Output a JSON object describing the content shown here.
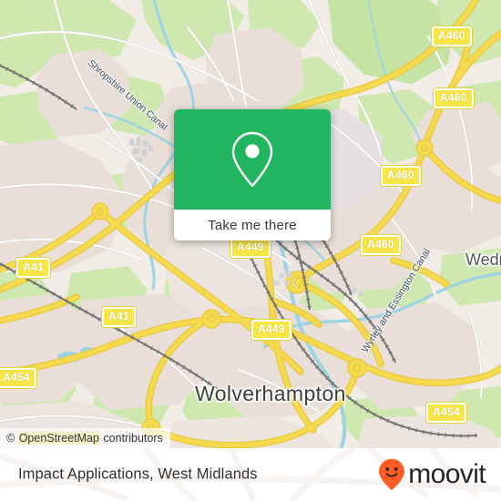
{
  "map": {
    "attribution": {
      "symbol": "©",
      "osm": "OpenStreetMap",
      "suffix": " contributors",
      "full": "© OpenStreetMap contributors"
    },
    "place_labels": [
      {
        "name": "Wolverhampton",
        "text": "Wolverhampton"
      },
      {
        "name": "Wednesfield",
        "text": "Wedn"
      }
    ],
    "water_labels": [
      {
        "name": "shropshire-union-canal",
        "text": "Shropshire Union Canal"
      },
      {
        "name": "wyrley-and-essington-canal",
        "text": "Wyrley and Essington Canal"
      }
    ],
    "road_shields": [
      {
        "id": "a460-top-right",
        "text": "A460"
      },
      {
        "id": "a460-upper-right",
        "text": "A460"
      },
      {
        "id": "a460-right",
        "text": "A460"
      },
      {
        "id": "a460-mid",
        "text": "A460"
      },
      {
        "id": "a41-left",
        "text": "A41"
      },
      {
        "id": "a41-lower-left",
        "text": "A41"
      },
      {
        "id": "a454-left",
        "text": "A454"
      },
      {
        "id": "a454-right",
        "text": "A454"
      },
      {
        "id": "a449-center",
        "text": "A449"
      },
      {
        "id": "a449-behind-card",
        "text": "A449"
      }
    ],
    "colors": {
      "land": "#f1ece6",
      "green": "#cfe8b0",
      "residential": "#ece3dc",
      "water": "#9ed3e3",
      "major_road": "#f5d94e",
      "rail": "#6b6b6b",
      "shield_fill": "#f7e64a"
    }
  },
  "popup": {
    "name": "take-me-there-card",
    "pin_icon": "map-pin-icon",
    "button_label": "Take me there",
    "accent_color": "#22b560"
  },
  "footer": {
    "title": "Impact Applications, West Midlands",
    "brand": {
      "word": "moovit",
      "icon": "moovit-pin-smile-icon",
      "color": "#ff5b25",
      "text_color": "#24242c"
    }
  }
}
